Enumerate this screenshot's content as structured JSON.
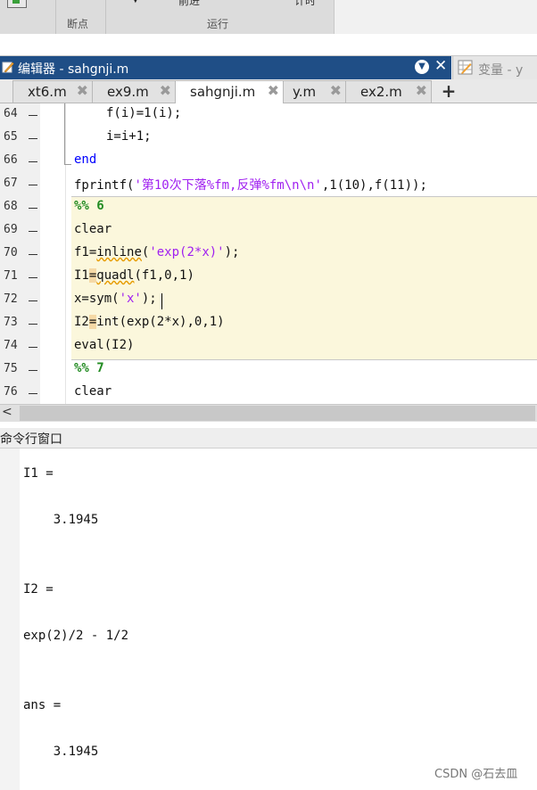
{
  "toolstrip": {
    "sections": [
      {
        "label": "断点"
      },
      {
        "label": "运行"
      }
    ],
    "cut_labels": [
      "前进",
      "计时"
    ]
  },
  "editor": {
    "title": "编辑器 - sahgnji.m",
    "variables_title": "变量 - y",
    "tabs": [
      {
        "label": "xt6.m",
        "active": false
      },
      {
        "label": "ex9.m",
        "active": false
      },
      {
        "label": "sahgnji.m",
        "active": true
      },
      {
        "label": "y.m",
        "active": false
      },
      {
        "label": "ex2.m",
        "active": false
      }
    ],
    "add_tab": "+",
    "line_numbers": [
      "64",
      "65",
      "66",
      "67",
      "68",
      "69",
      "70",
      "71",
      "72",
      "73",
      "74",
      "75",
      "76"
    ],
    "code": {
      "l64": [
        "f(i)=1(i);"
      ],
      "l65": [
        "i=i+1;"
      ],
      "l66": [
        "end"
      ],
      "l67": [
        "fprintf(",
        "'第10次下落%fm,反弹%fm\\n\\n'",
        ",1(10),f(11));"
      ],
      "l68": [
        "%% 6"
      ],
      "l69": [
        "clear"
      ],
      "l70": [
        "f1=",
        "inline",
        "(",
        "'exp(2*x)'",
        ");"
      ],
      "l71": [
        "I1",
        "=",
        "quadl",
        "(f1,0,1)"
      ],
      "l72": [
        "x=sym(",
        "'x'",
        ");"
      ],
      "l73": [
        "I2",
        "=",
        "int(exp(2*x),0,1)"
      ],
      "l74": [
        "eval(I2)"
      ],
      "l75": [
        "%% 7"
      ],
      "l76": [
        "clear"
      ]
    }
  },
  "command_window": {
    "title": "命令行窗口",
    "output": [
      {
        "text": "I1 ="
      },
      {
        "text": "    3.1945"
      },
      {
        "text": "I2 ="
      },
      {
        "text": "exp(2)/2 - 1/2"
      },
      {
        "text": "ans ="
      },
      {
        "text": "    3.1945"
      }
    ]
  },
  "watermark": "CSDN @石去皿",
  "colors": {
    "editor_titlebar": "#1f4e86",
    "string": "#a020f0",
    "keyword": "#0000ff",
    "cell_marker": "#228b22",
    "cell_background": "#fbf7dc"
  }
}
